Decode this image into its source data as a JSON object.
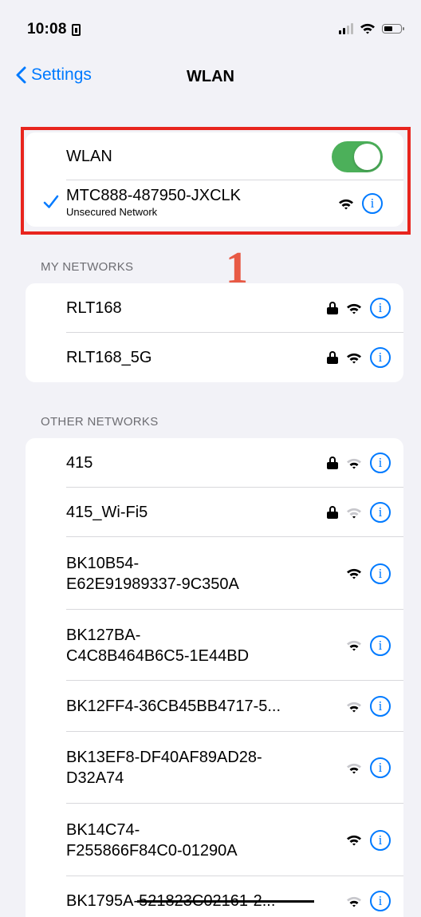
{
  "status_bar": {
    "time": "10:08"
  },
  "nav": {
    "back_label": "Settings",
    "title": "WLAN"
  },
  "wlan": {
    "toggle_label": "WLAN",
    "toggle_on": true,
    "connected": {
      "name": "MTC888-487950-JXCLK",
      "subtitle": "Unsecured Network"
    }
  },
  "annotation": {
    "marker": "1",
    "color": "#e8251e"
  },
  "my_networks": {
    "header": "MY NETWORKS",
    "items": [
      {
        "name": "RLT168",
        "secured": true
      },
      {
        "name": "RLT168_5G",
        "secured": true
      }
    ]
  },
  "other_networks": {
    "header": "OTHER NETWORKS",
    "items": [
      {
        "name": "415",
        "secured": true
      },
      {
        "name": "415_Wi-Fi5",
        "secured": true
      },
      {
        "name": "BK10B54-\nE62E91989337-9C350A",
        "secured": false
      },
      {
        "name": "BK127BA-\nC4C8B464B6C5-1E44BD",
        "secured": false
      },
      {
        "name": "BK12FF4-36CB45BB4717-5...",
        "secured": false
      },
      {
        "name": "BK13EF8-DF40AF89AD28-\nD32A74",
        "secured": false
      },
      {
        "name": "BK14C74-\nF255866F84C0-01290A",
        "secured": false
      },
      {
        "name": "BK1795A-521823C02161-2...",
        "secured": false
      }
    ]
  },
  "icons": {
    "wifi": "wifi-icon",
    "info": "info-icon",
    "lock": "lock-icon",
    "check": "checkmark-icon",
    "back": "chevron-left-icon"
  },
  "colors": {
    "accent": "#007aff",
    "toggle_on": "#4cb05a",
    "highlight": "#e8251e",
    "background": "#f2f2f7"
  }
}
